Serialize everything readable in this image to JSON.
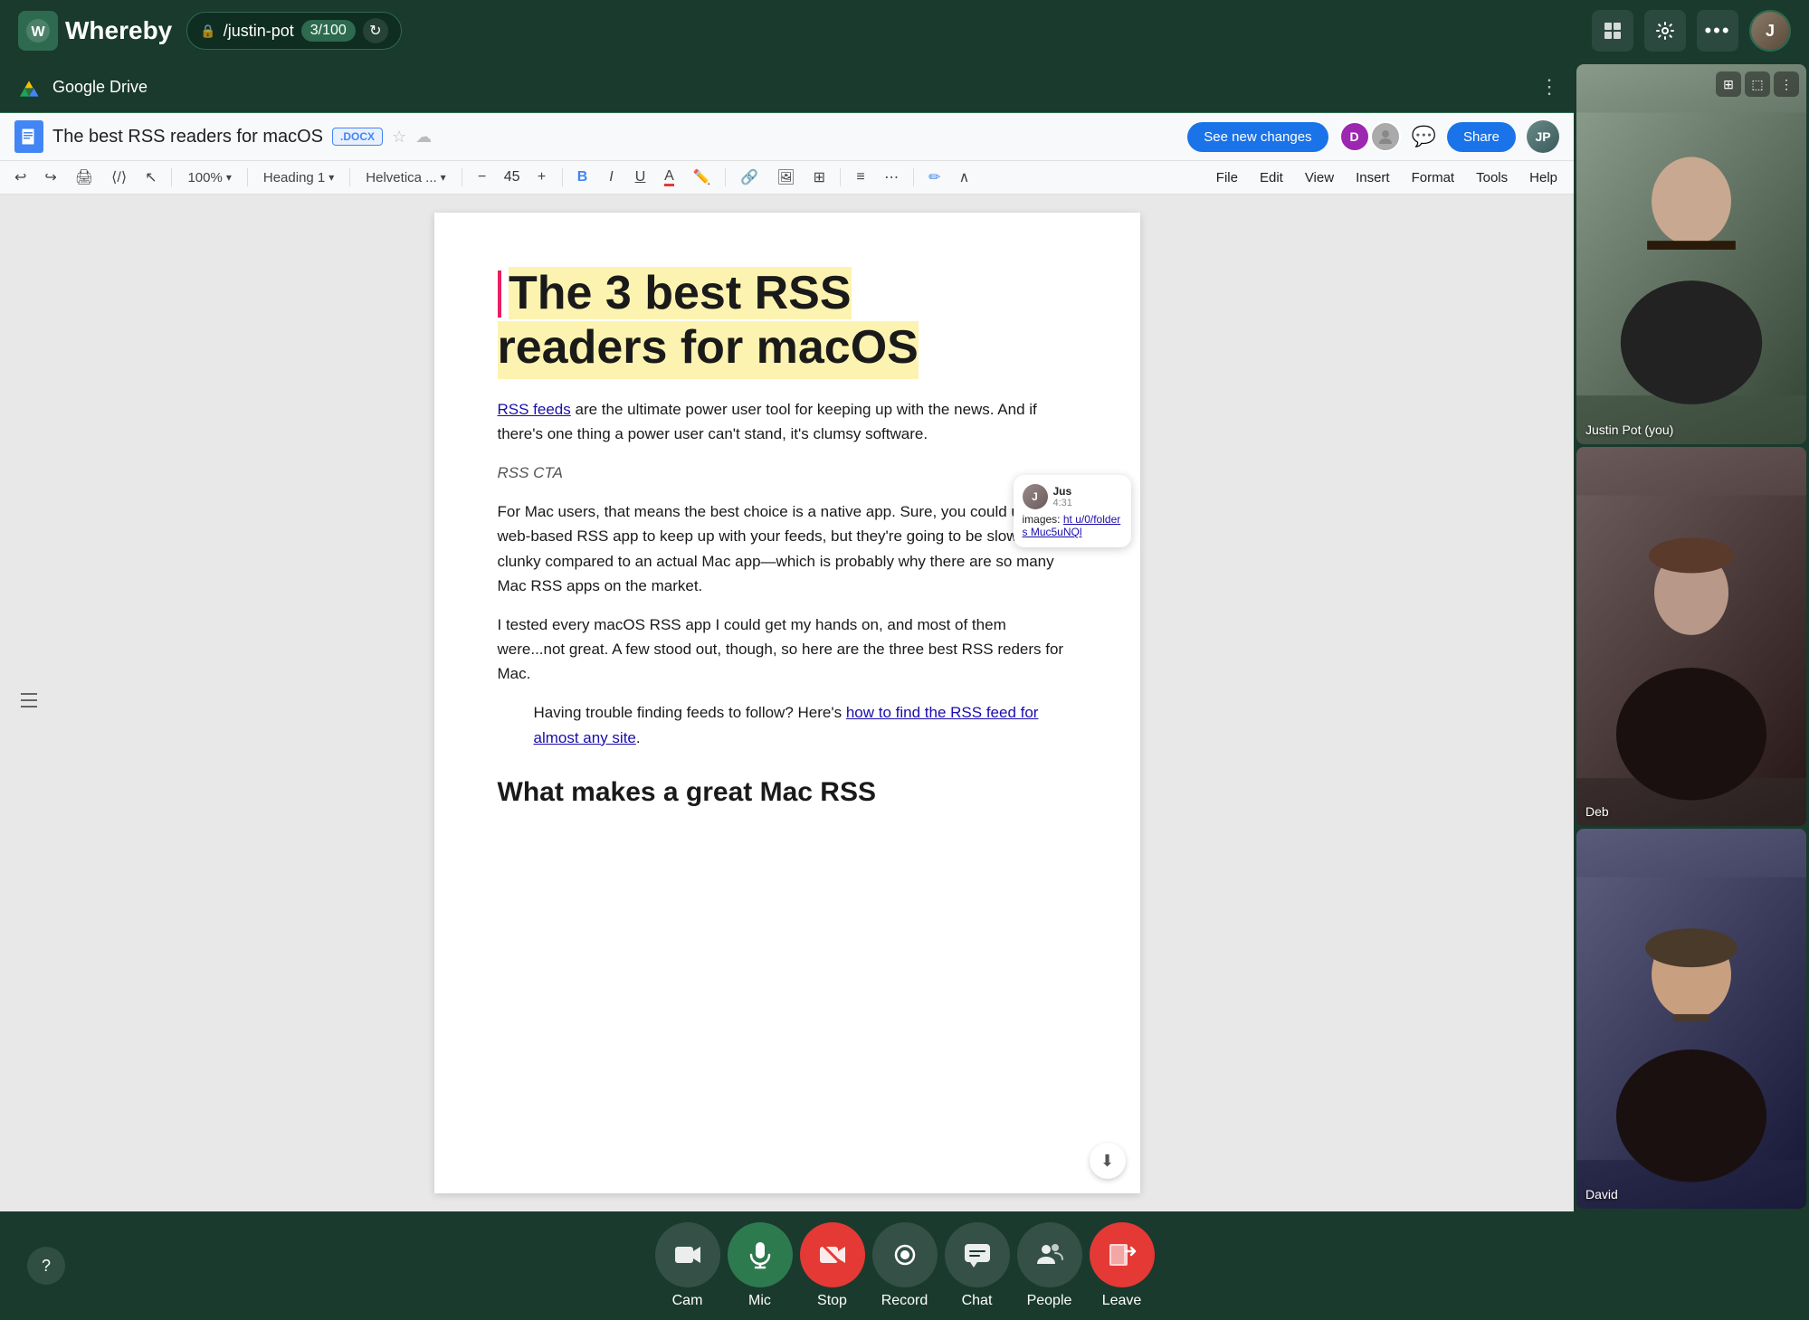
{
  "app": {
    "name": "Whereby",
    "logo_text": "W"
  },
  "top_bar": {
    "room_path": "/justin-pot",
    "count": "3/100",
    "grid_icon": "⊞",
    "gear_icon": "⚙",
    "more_icon": "···"
  },
  "gdrive": {
    "title": "Google Drive",
    "more_icon": "⋮"
  },
  "doc": {
    "title": "The best RSS readers for macOS",
    "badge": ".DOCX",
    "menu_items": [
      "File",
      "Edit",
      "View",
      "Insert",
      "Format",
      "Tools",
      "Help"
    ],
    "see_new_changes": "See new changes",
    "share": "Share",
    "zoom": "100%",
    "heading_style": "Heading 1",
    "font": "Helvetica ...",
    "font_size": "45",
    "heading_line1": "The 3 best RSS",
    "heading_line2": "readers for macOS",
    "link_text": "RSS feeds",
    "para1": " are the ultimate power user tool for keeping up with the news. And if there's one thing a power user can't stand, it's clumsy software.",
    "rss_cta": "RSS CTA",
    "para2": "For Mac users, that means the best choice is a native app. Sure, you could use a web-based RSS app to keep up with your feeds, but they're going to be slow and clunky compared to an actual Mac app—which is probably why there are so many Mac RSS apps on the market.",
    "para3": "I tested every macOS RSS app I could get my hands on, and most of them were...not great. A few stood out, though, so here are the three best RSS reders for Mac.",
    "blockquote_text": "Having trouble finding feeds to follow? Here's ",
    "blockquote_link": "how to find the RSS feed for almost any site",
    "blockquote_end": ".",
    "subheading": "What makes a great Mac RSS"
  },
  "chat_bubble": {
    "name": "Jus",
    "time": "4:31",
    "message_prefix": "images: ",
    "link": "ht u/0/folders Muc5uNQl"
  },
  "videos": [
    {
      "id": "justin",
      "name": "Justin Pot (you)",
      "bg_class": "justin-bg"
    },
    {
      "id": "deb",
      "name": "Deb",
      "bg_class": "deb-bg"
    },
    {
      "id": "david",
      "name": "David",
      "bg_class": "david-bg"
    }
  ],
  "controls": [
    {
      "id": "cam",
      "icon": "📷",
      "label": "Cam",
      "active": false
    },
    {
      "id": "mic",
      "icon": "🎤",
      "label": "Mic",
      "active": true
    },
    {
      "id": "stop",
      "icon": "⬛",
      "label": "Stop",
      "active": true
    },
    {
      "id": "record",
      "icon": "⏺",
      "label": "Record",
      "active": false
    },
    {
      "id": "chat",
      "icon": "💬",
      "label": "Chat",
      "active": false
    },
    {
      "id": "people",
      "icon": "👥",
      "label": "People",
      "active": false
    },
    {
      "id": "leave",
      "icon": "🚪",
      "label": "Leave",
      "active": true
    }
  ]
}
